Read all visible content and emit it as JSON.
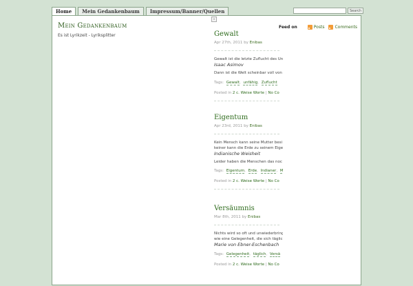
{
  "nav": {
    "tabs": [
      {
        "label": "Home",
        "active": true
      },
      {
        "label": "Mein Gedankenbaum",
        "active": false
      },
      {
        "label": "Impressum/Banner/Quellen",
        "active": false
      }
    ],
    "search": {
      "value": "",
      "button_label": "Search"
    }
  },
  "header": {
    "title": "Mein Gedankenbaum",
    "description": "Es ist Lyrikzeit - Lyriksplitter"
  },
  "feed": {
    "label": "Feed on",
    "posts_label": "Posts",
    "comments_label": "Comments"
  },
  "close_marker": "×",
  "posts": [
    {
      "title": "Gewalt",
      "date": "Apr 27th, 2011",
      "by": "by",
      "author": "Enibas",
      "lines": [
        {
          "text": "Gewalt ist die letzte Zuflucht des Unf",
          "quote": false
        },
        {
          "text": "Isaac Asimov",
          "quote": true
        },
        {
          "text": "Dann ist die Welt scheinbar voll von",
          "quote": false
        }
      ],
      "tags_label": "Tags:",
      "tags": [
        "Gewalt",
        "unfähig",
        "Zuflucht"
      ],
      "posted_label": "Posted in",
      "categories": "2 c. Weise Worte",
      "separator": "|",
      "comments": "No Co"
    },
    {
      "title": "Eigentum",
      "date": "Apr 23rd, 2011",
      "by": "by",
      "author": "Enibas",
      "lines": [
        {
          "text": "Kein Mensch kann seine Mutter besi",
          "quote": false
        },
        {
          "text": "keiner kann die Erde zu seinem Eige",
          "quote": false
        },
        {
          "text": "Indianische Weisheit",
          "quote": true
        },
        {
          "text": "Leider haben die Menschen das noc",
          "quote": false
        }
      ],
      "tags_label": "Tags:",
      "tags": [
        "Eigentum",
        "Erde",
        "Indianer",
        "Mu"
      ],
      "posted_label": "Posted in",
      "categories": "2 c. Weise Worte",
      "separator": "|",
      "comments": "No Co"
    },
    {
      "title": "Versäumnis",
      "date": "Mar 8th, 2011",
      "by": "by",
      "author": "Enibas",
      "lines": [
        {
          "text": "Nichts wird so oft und unwiederbring",
          "quote": false
        },
        {
          "text": "wie eine Gelegenheit, die sich täglich",
          "quote": false
        },
        {
          "text": "Marie von Ebner-Eschenbach",
          "quote": true
        }
      ],
      "tags_label": "Tags:",
      "tags": [
        "Gelegenheit",
        "täglich",
        "Versä"
      ],
      "posted_label": "Posted in",
      "categories": "2 c. Weise Worte",
      "separator": "|",
      "comments": "No Co"
    }
  ]
}
